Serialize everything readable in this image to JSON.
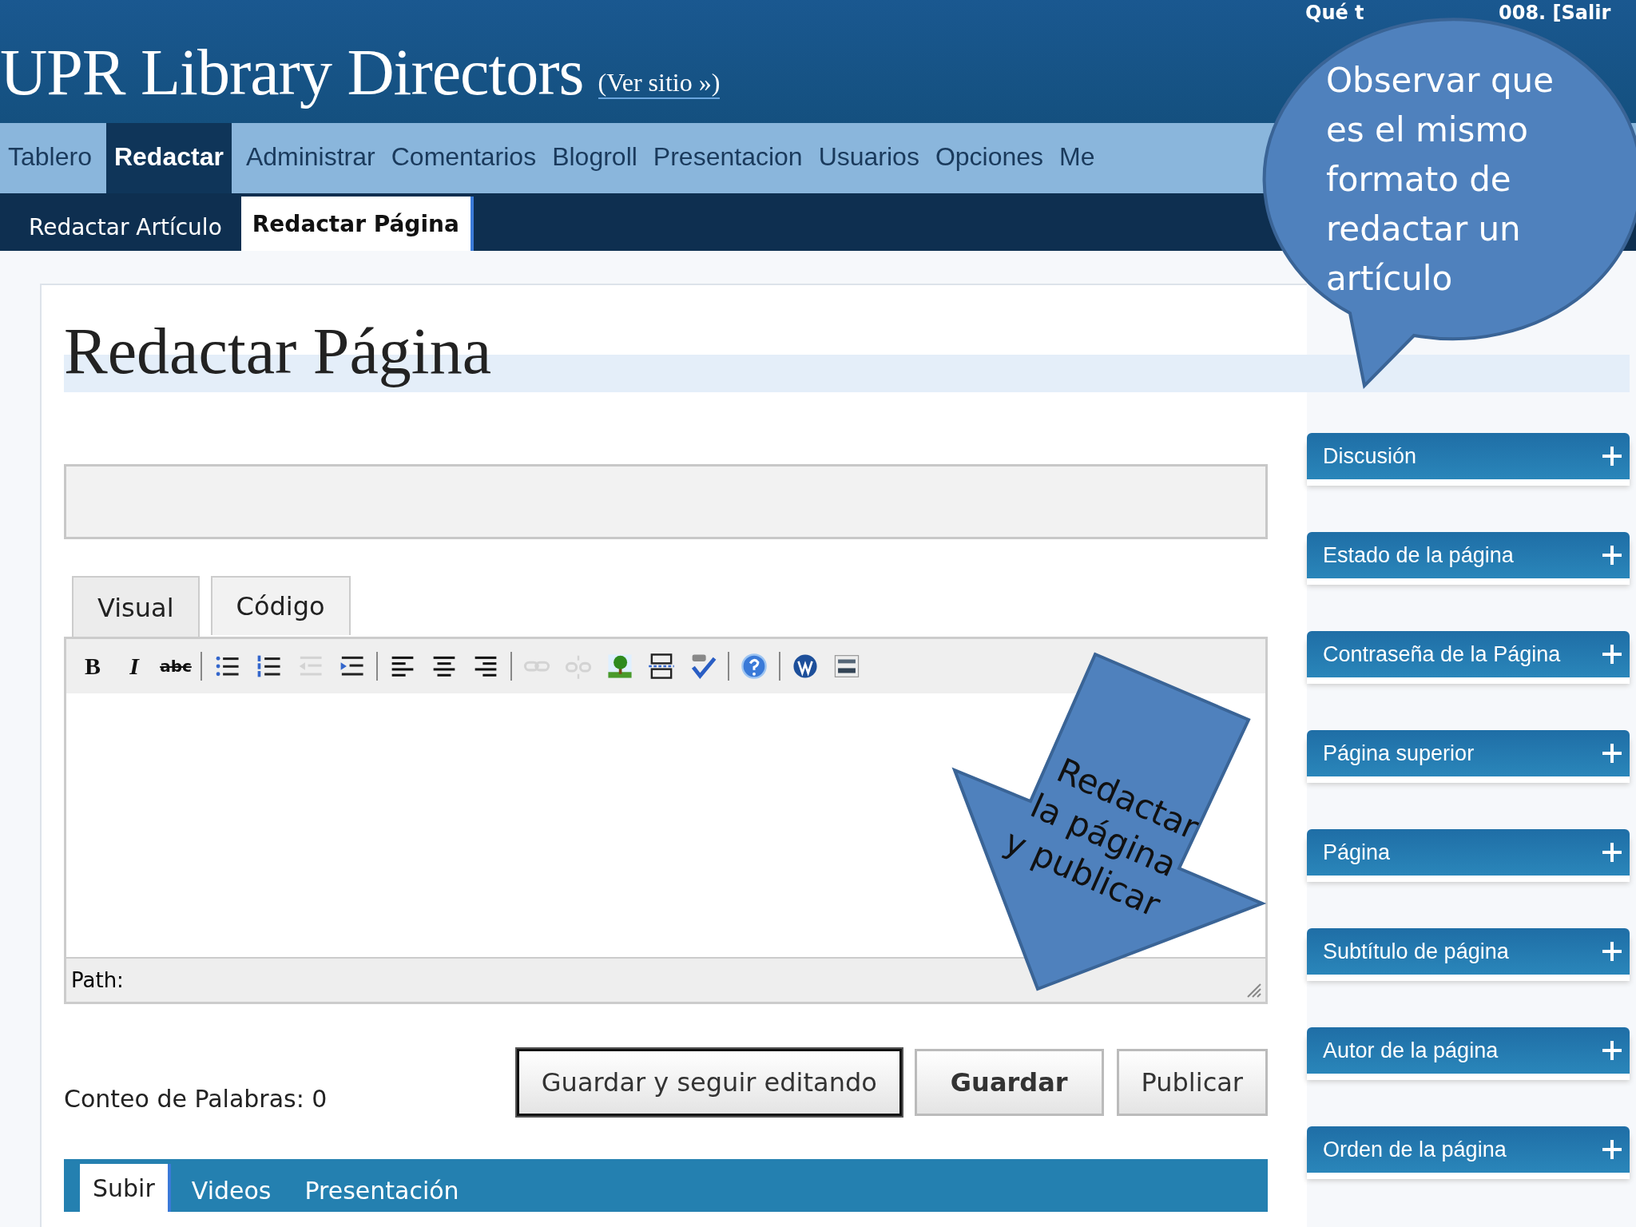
{
  "header": {
    "site_title": "UPR Library Directors",
    "view_site_link": "(Ver sitio »)",
    "user_greeting_start": "Qué t",
    "user_greeting_end": "008. [Salir"
  },
  "nav": [
    {
      "label": "Tablero",
      "selected": false
    },
    {
      "label": "Redactar",
      "selected": true
    },
    {
      "label": "Administrar",
      "selected": false
    },
    {
      "label": "Comentarios",
      "selected": false
    },
    {
      "label": "Blogroll",
      "selected": false
    },
    {
      "label": "Presentacion",
      "selected": false
    },
    {
      "label": "Usuarios",
      "selected": false
    },
    {
      "label": "Opciones",
      "selected": false
    },
    {
      "label": "Me",
      "selected": false
    }
  ],
  "subnav": [
    {
      "label": "Redactar Artículo",
      "selected": false
    },
    {
      "label": "Redactar Página",
      "selected": true
    }
  ],
  "page_heading": "Redactar Página",
  "editor_tabs": [
    {
      "label": "Visual",
      "selected": true
    },
    {
      "label": "Código",
      "selected": false
    }
  ],
  "toolbar": [
    {
      "kind": "text",
      "label": "B",
      "disabled": false
    },
    {
      "kind": "text",
      "label": "I",
      "disabled": false
    },
    {
      "kind": "text",
      "label": "abc",
      "disabled": false
    },
    {
      "kind": "separator"
    },
    {
      "kind": "icon",
      "disabled": false
    },
    {
      "kind": "icon",
      "disabled": false
    },
    {
      "kind": "icon",
      "disabled": true
    },
    {
      "kind": "icon",
      "disabled": false
    },
    {
      "kind": "separator"
    },
    {
      "kind": "icon",
      "disabled": false
    },
    {
      "kind": "icon",
      "disabled": false
    },
    {
      "kind": "icon",
      "disabled": false
    },
    {
      "kind": "separator"
    },
    {
      "kind": "icon",
      "disabled": true
    },
    {
      "kind": "icon",
      "disabled": true
    },
    {
      "kind": "icon",
      "disabled": false
    },
    {
      "kind": "icon",
      "disabled": false
    },
    {
      "kind": "icon",
      "disabled": false
    },
    {
      "kind": "separator"
    },
    {
      "kind": "icon",
      "disabled": false
    },
    {
      "kind": "separator"
    },
    {
      "kind": "icon",
      "disabled": false
    },
    {
      "kind": "icon",
      "disabled": false
    }
  ],
  "path_label": "Path:",
  "word_count": "Conteo de Palabras: 0",
  "buttons": [
    {
      "label": "Guardar y seguir editando",
      "primary": false,
      "focused": true
    },
    {
      "label": "Guardar",
      "primary": true,
      "focused": false
    },
    {
      "label": "Publicar",
      "primary": false,
      "focused": false
    }
  ],
  "media_tabs": [
    {
      "label": "Subir",
      "selected": true
    },
    {
      "label": "Videos",
      "selected": false
    },
    {
      "label": "Presentación",
      "selected": false
    }
  ],
  "sidebar": [
    {
      "label": "Discusión"
    },
    {
      "label": "Estado de la página"
    },
    {
      "label": "Contraseña de la Página"
    },
    {
      "label": "Página superior"
    },
    {
      "label": "Página"
    },
    {
      "label": "Subtítulo de página"
    },
    {
      "label": "Autor de la página"
    },
    {
      "label": "Orden de la página"
    }
  ],
  "callouts": [
    {
      "kind": "bubble",
      "text": "Observar que es el mismo formato de redactar un artículo"
    },
    {
      "kind": "arrow",
      "lines": [
        "Redactar",
        "la página",
        "y publicar"
      ]
    }
  ]
}
